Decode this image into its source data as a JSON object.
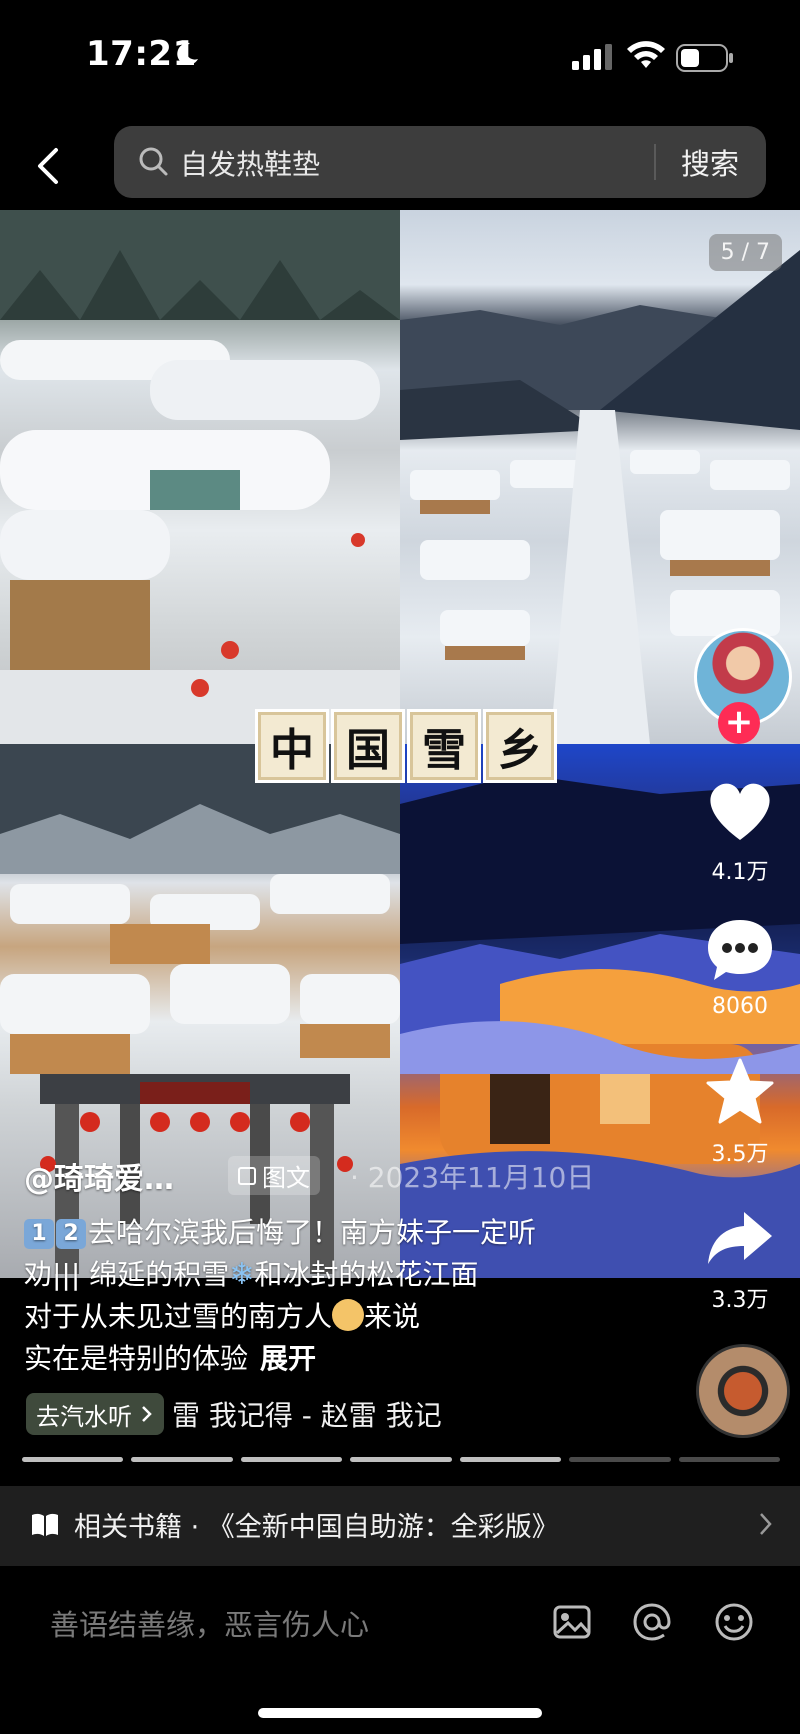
{
  "status_bar": {
    "time": "17:21"
  },
  "header": {
    "search_query": "自发热鞋垫",
    "search_button": "搜索"
  },
  "post": {
    "pager": "5 / 7",
    "title_chars": [
      "中",
      "国",
      "雪",
      "乡"
    ],
    "author": "@琦琦爱…",
    "type_label": "图文",
    "date": "· 2023年11月10日",
    "caption_line1": "去哈尔滨我后悔了！南方妹子一定听",
    "caption_line2a": "劝||| 绵延的积雪",
    "caption_line2b": "和冰封的松花江面",
    "caption_line3a": "对于从未见过雪的南方人",
    "caption_line3b": "来说",
    "caption_line4": "实在是特别的体验",
    "expand_label": "展开",
    "num_chips": [
      "1",
      "2"
    ],
    "music_chip": "去汽水听",
    "music_text": "雷   我记得 - 赵雷   我记"
  },
  "actions": {
    "likes": "4.1万",
    "comments": "8060",
    "favorites": "3.5万",
    "shares": "3.3万"
  },
  "progress": {
    "total": 7,
    "current": 5
  },
  "related": {
    "text": "相关书籍 · 《全新中国自助游：全彩版》"
  },
  "comment_bar": {
    "placeholder": "善语结善缘，恶言伤人心"
  },
  "colors": {
    "follow": "#fe2c55",
    "background": "#000000",
    "panel": "#1f1f1f"
  },
  "icons": [
    "moon-icon",
    "signal-icon",
    "wifi-icon",
    "battery-icon",
    "back-icon",
    "search-icon",
    "heart-icon",
    "comment-icon",
    "star-icon",
    "share-icon",
    "book-icon",
    "chevron-right-icon",
    "image-icon",
    "at-icon",
    "emoji-icon"
  ]
}
